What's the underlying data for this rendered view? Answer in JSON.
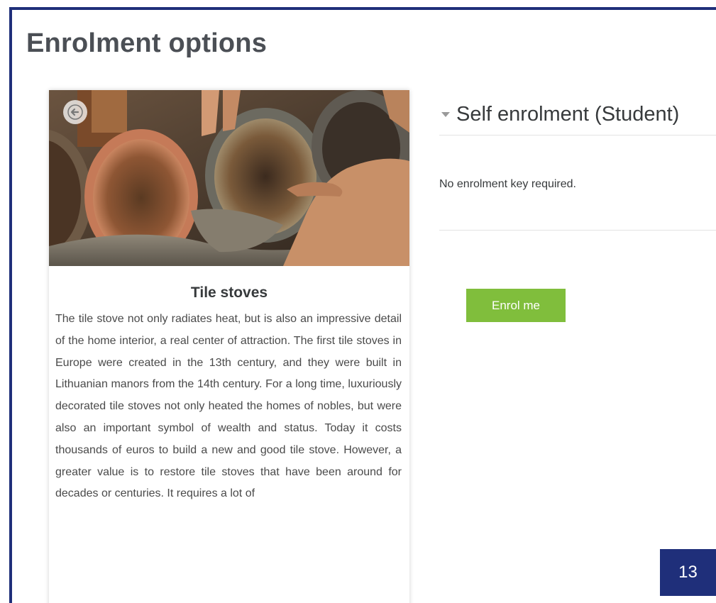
{
  "page": {
    "title": "Enrolment options"
  },
  "course": {
    "name": "Tile stoves",
    "summary": "The tile stove not only radiates heat, but is also an impressive detail of the home interior, a real center of attraction. The first tile stoves in Europe were created in the 13th century, and they were built in Lithuanian manors from the 14th century. For a long time, luxuriously decorated tile stoves not only heated the homes of nobles, but were also an important symbol of wealth and status. Today it costs thousands of euros to build a new and good tile stove. However, a greater value is to restore tile stoves that have been around for decades or centuries. It requires a lot of",
    "image_icon": "enrol-arrow-icon"
  },
  "enrolment": {
    "section_title": "Self enrolment (Student)",
    "key_info": "No enrolment key required.",
    "button_label": "Enrol me",
    "button_color": "#80be3c"
  },
  "slide": {
    "number": "13",
    "accent_color": "#1f2f7a"
  }
}
